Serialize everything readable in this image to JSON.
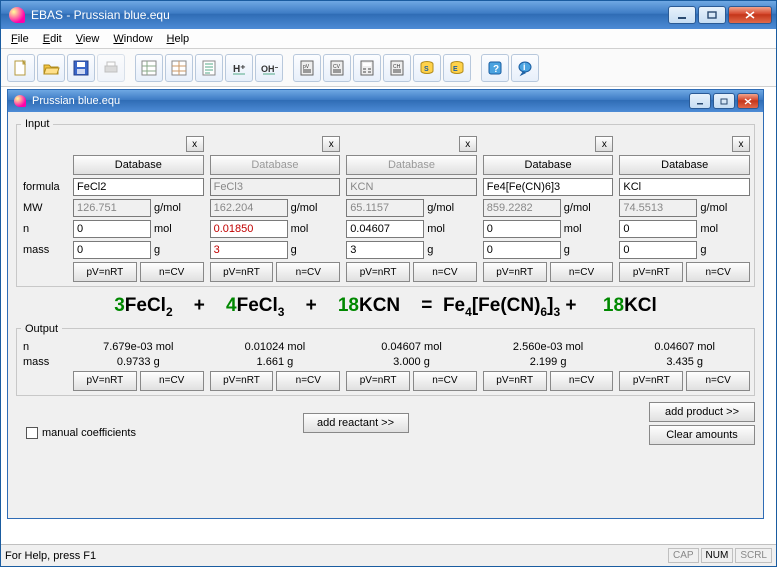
{
  "window": {
    "title": "EBAS - Prussian blue.equ",
    "child_title": "Prussian blue.equ"
  },
  "menu": {
    "file": "File",
    "edit": "Edit",
    "view": "View",
    "window": "Window",
    "help": "Help"
  },
  "labels": {
    "input_legend": "Input",
    "output_legend": "Output",
    "formula": "formula",
    "mw": "MW",
    "n": "n",
    "mass": "mass",
    "unit_gmol": "g/mol",
    "unit_mol": "mol",
    "unit_g": "g",
    "database": "Database",
    "clear": "x",
    "pvnrt": "pV=nRT",
    "ncv": "n=CV",
    "add_reactant": "add reactant >>",
    "add_product": "add product >>",
    "clear_amounts": "Clear amounts",
    "manual_coef": "manual coefficients"
  },
  "species": [
    {
      "db_enabled": true,
      "formula": "FeCl2",
      "mw": "126.751",
      "n": "0",
      "n_red": false,
      "mass": "0",
      "mass_red": false
    },
    {
      "db_enabled": false,
      "formula": "FeCl3",
      "mw": "162.204",
      "n": "0.01850",
      "n_red": true,
      "mass": "3",
      "mass_red": true
    },
    {
      "db_enabled": false,
      "formula": "KCN",
      "mw": "65.1157",
      "n": "0.04607",
      "n_red": false,
      "mass": "3",
      "mass_red": false
    },
    {
      "db_enabled": true,
      "formula": "Fe4[Fe(CN)6]3",
      "mw": "859.2282",
      "n": "0",
      "n_red": false,
      "mass": "0",
      "mass_red": false
    },
    {
      "db_enabled": true,
      "formula": "KCl",
      "mw": "74.5513",
      "n": "0",
      "n_red": false,
      "mass": "0",
      "mass_red": false
    }
  ],
  "equation": {
    "parts": [
      {
        "coef": "3",
        "formula": "FeCl",
        "sub": "2"
      },
      {
        "op": "+"
      },
      {
        "coef": "4",
        "formula": "FeCl",
        "sub": "3"
      },
      {
        "op": "+"
      },
      {
        "coef": "18",
        "formula": "KCN"
      },
      {
        "op": "="
      },
      {
        "formula_html": "Fe<sub>4</sub>[Fe(CN)<sub>6</sub>]<sub>3</sub>"
      },
      {
        "op": "+"
      },
      {
        "coef": "18",
        "formula": "KCl"
      }
    ]
  },
  "output": [
    {
      "n": "7.679e-03 mol",
      "mass": "0.9733 g"
    },
    {
      "n": "0.01024 mol",
      "mass": "1.661 g"
    },
    {
      "n": "0.04607 mol",
      "mass": "3.000 g"
    },
    {
      "n": "2.560e-03 mol",
      "mass": "2.199 g"
    },
    {
      "n": "0.04607 mol",
      "mass": "3.435 g"
    }
  ],
  "statusbar": {
    "help": "For Help, press F1",
    "cap": "CAP",
    "num": "NUM",
    "scrl": "SCRL"
  }
}
